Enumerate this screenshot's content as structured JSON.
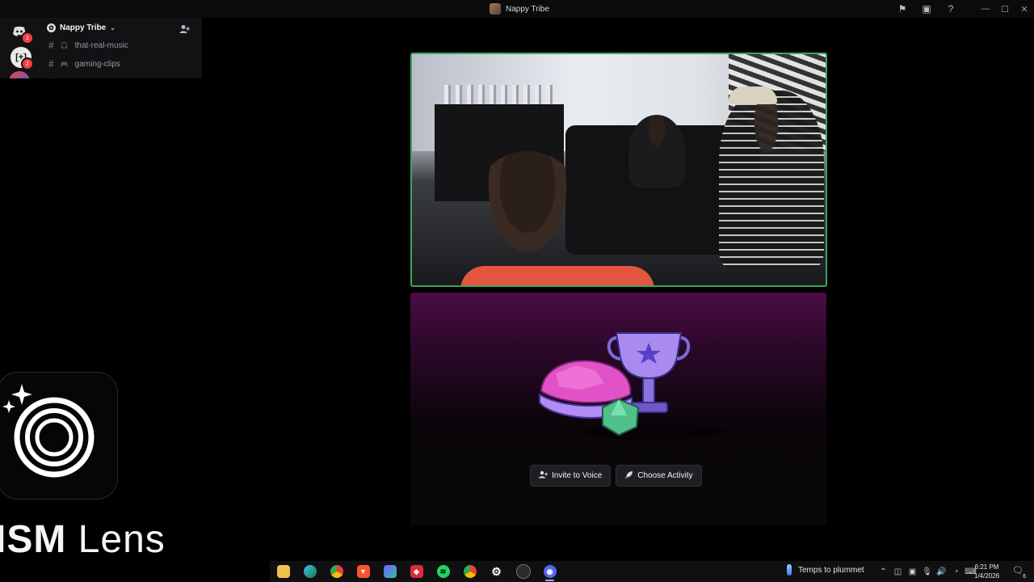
{
  "window": {
    "title": "Nappy Tribe",
    "icons": [
      "flag-icon",
      "inbox-icon",
      "help-icon"
    ],
    "controls": [
      "minimize",
      "maximize",
      "close"
    ]
  },
  "overlay": {
    "server_name": "Nappy Tribe",
    "rail": [
      {
        "name": "discord-home",
        "badge": "1"
      },
      {
        "name": "server",
        "badge": "2"
      }
    ],
    "channels": [
      {
        "name": "that-real-music",
        "emoji": "🎧"
      },
      {
        "name": "gaming-clips",
        "emoji": "🎮"
      }
    ]
  },
  "activity": {
    "invite_label": "Invite to Voice",
    "choose_label": "Choose Activity"
  },
  "logo": {
    "text_bold": "ISM",
    "text_light": " Lens"
  },
  "taskbar": {
    "weather_text": "Temps to plummet",
    "time": "6:21 PM",
    "date": "1/4/2026",
    "notification_count": "6"
  },
  "colors": {
    "speaking_border": "#3ba55c",
    "activity_gradient_top": "#4a0c44",
    "badge": "#f23f43"
  }
}
